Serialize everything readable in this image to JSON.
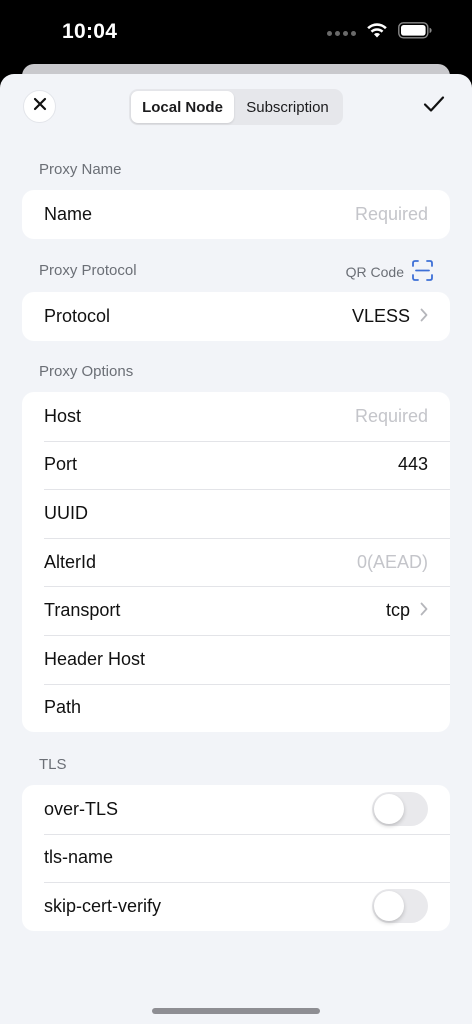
{
  "status_bar": {
    "time": "10:04",
    "icons": [
      "signal-dots-icon",
      "wifi-icon",
      "battery-icon"
    ]
  },
  "header": {
    "close_icon": "close-icon",
    "confirm_icon": "checkmark-icon",
    "tabs": [
      {
        "label": "Local Node",
        "selected": true
      },
      {
        "label": "Subscription",
        "selected": false
      }
    ]
  },
  "sections": {
    "proxy_name": {
      "header": "Proxy Name",
      "rows": [
        {
          "label": "Name",
          "placeholder": "Required"
        }
      ]
    },
    "proxy_protocol": {
      "header": "Proxy Protocol",
      "qr_label": "QR Code",
      "qr_icon": "qr-scan-icon",
      "rows": [
        {
          "label": "Protocol",
          "value": "VLESS"
        }
      ]
    },
    "proxy_options": {
      "header": "Proxy Options",
      "rows": [
        {
          "label": "Host",
          "placeholder": "Required"
        },
        {
          "label": "Port",
          "value": "443"
        },
        {
          "label": "UUID",
          "value": ""
        },
        {
          "label": "AlterId",
          "placeholder": "0(AEAD)"
        },
        {
          "label": "Transport",
          "value": "tcp"
        },
        {
          "label": "Header Host",
          "value": ""
        },
        {
          "label": "Path",
          "value": ""
        }
      ]
    },
    "tls": {
      "header": "TLS",
      "rows": [
        {
          "label": "over-TLS",
          "toggle_on": false
        },
        {
          "label": "tls-name",
          "value": ""
        },
        {
          "label": "skip-cert-verify",
          "toggle_on": false
        }
      ]
    }
  },
  "colors": {
    "accent": "#3d6fd6",
    "background": "#f2f4f8",
    "card": "#ffffff",
    "secondary_text": "#6b6f76",
    "placeholder": "#c4c5ca"
  }
}
